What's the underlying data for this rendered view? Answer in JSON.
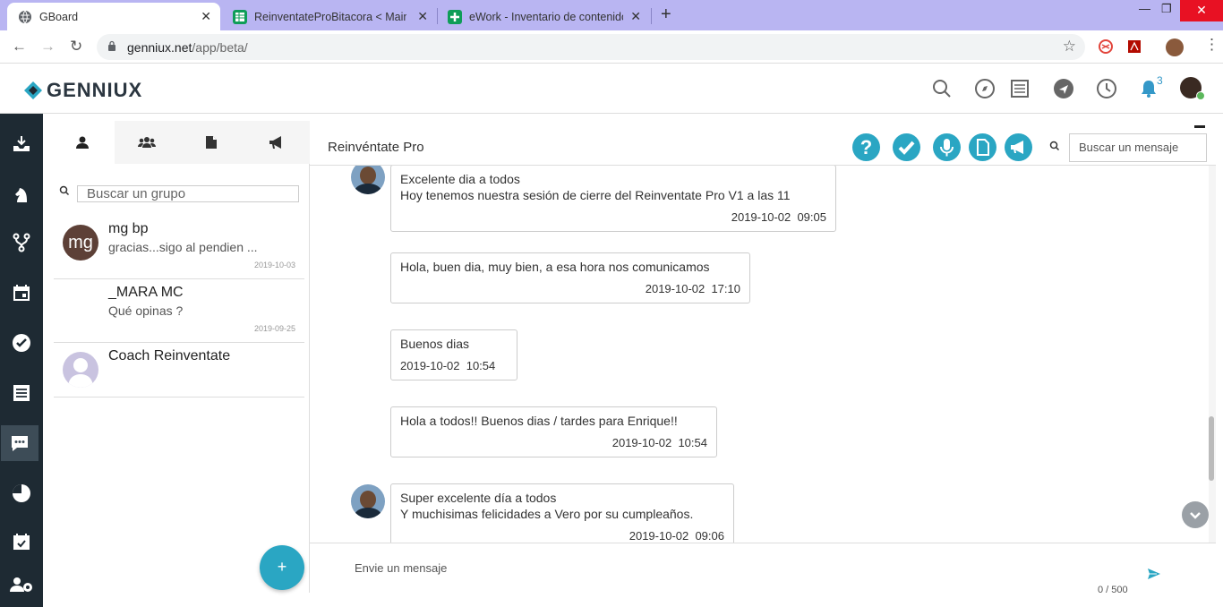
{
  "browser": {
    "tabs": [
      {
        "title": "GBoard",
        "favicon": "globe-icon",
        "active": true
      },
      {
        "title": "ReinventateProBitacora < Main <",
        "favicon": "sheets-icon",
        "active": false
      },
      {
        "title": "eWork - Inventario de contenido",
        "favicon": "sheets-plus-icon",
        "active": false
      }
    ],
    "url_host": "genniux.net",
    "url_path": "/app/beta/"
  },
  "app": {
    "brand": "GENNIUX",
    "notification_count": "3",
    "accent": "#2aa6c3",
    "nav_bg": "#1e2a33"
  },
  "groups_panel": {
    "search_placeholder": "Buscar un grupo",
    "items": [
      {
        "name": "mg bp",
        "avatar_text": "mg",
        "last_message": "gracias...sigo al pendien ...",
        "date": "2019-10-03"
      },
      {
        "name": "_MARA MC",
        "avatar_text": "",
        "last_message": "Qué opinas ?",
        "date": "2019-09-25"
      },
      {
        "name": "Coach Reinventate",
        "avatar_text": "",
        "last_message": "",
        "date": ""
      }
    ],
    "add_label": "+"
  },
  "chat": {
    "title": "Reinvéntate Pro",
    "search_placeholder": "Buscar un mensaje",
    "messages": [
      {
        "lines": [
          "Excelente dia a todos",
          "Hoy tenemos nuestra sesión de cierre del Reinventate Pro V1  a las 11"
        ],
        "time": "2019-10-02  09:05"
      },
      {
        "lines": [
          "Hola, buen dia, muy bien, a esa hora nos comunicamos"
        ],
        "time": "2019-10-02  17:10"
      },
      {
        "lines": [
          "Buenos dias"
        ],
        "time": "2019-10-02  10:54"
      },
      {
        "lines": [
          "Hola a todos!! Buenos dias / tardes para Enrique!!"
        ],
        "time": "2019-10-02  10:54"
      },
      {
        "lines": [
          "Super excelente día a todos",
          "Y muchisimas felicidades a Vero por su cumpleaños."
        ],
        "time": "2019-10-02  09:06"
      }
    ],
    "composer_placeholder": "Envie un mensaje",
    "char_counter": "0 / 500"
  }
}
